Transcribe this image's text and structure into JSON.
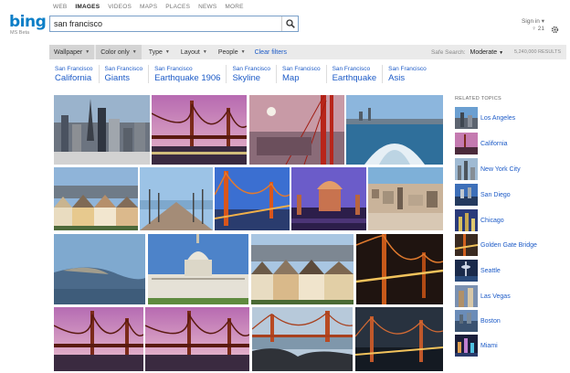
{
  "nav": [
    "WEB",
    "IMAGES",
    "VIDEOS",
    "MAPS",
    "PLACES",
    "NEWS",
    "MORE"
  ],
  "active_nav": "IMAGES",
  "logo": {
    "word": "bing",
    "sub": "MS Beta"
  },
  "search": {
    "value": "san francisco"
  },
  "signin": {
    "label": "Sign in",
    "points": "21"
  },
  "filters": [
    {
      "label": "Wallpaper"
    },
    {
      "label": "Color only"
    },
    {
      "label": "Type"
    },
    {
      "label": "Layout"
    },
    {
      "label": "People"
    }
  ],
  "clear_filters": "Clear filters",
  "safe_search": {
    "label": "Safe Search:",
    "value": "Moderate",
    "results": "5,240,000 RESULTS"
  },
  "related_searches": [
    {
      "small": "San Francisco",
      "large": "California"
    },
    {
      "small": "San Francisco",
      "large": "Giants"
    },
    {
      "small": "San Francisco",
      "large": "Earthquake 1906"
    },
    {
      "small": "San Francisco",
      "large": "Skyline"
    },
    {
      "small": "San Francisco",
      "large": "Map"
    },
    {
      "small": "San Francisco",
      "large": "Earthquake"
    },
    {
      "small": "San Francisco",
      "large": "Asis"
    }
  ],
  "related_topics_title": "RELATED TOPICS",
  "related_topics": [
    "Los Angeles",
    "California",
    "New York City",
    "San Diego",
    "Chicago",
    "Golden Gate Bridge",
    "Seattle",
    "Las Vegas",
    "Boston",
    "Miami"
  ],
  "colors": {
    "link": "#1d5bc7",
    "logo": "#0b7ec7",
    "filterbar": "#eaeaea"
  }
}
